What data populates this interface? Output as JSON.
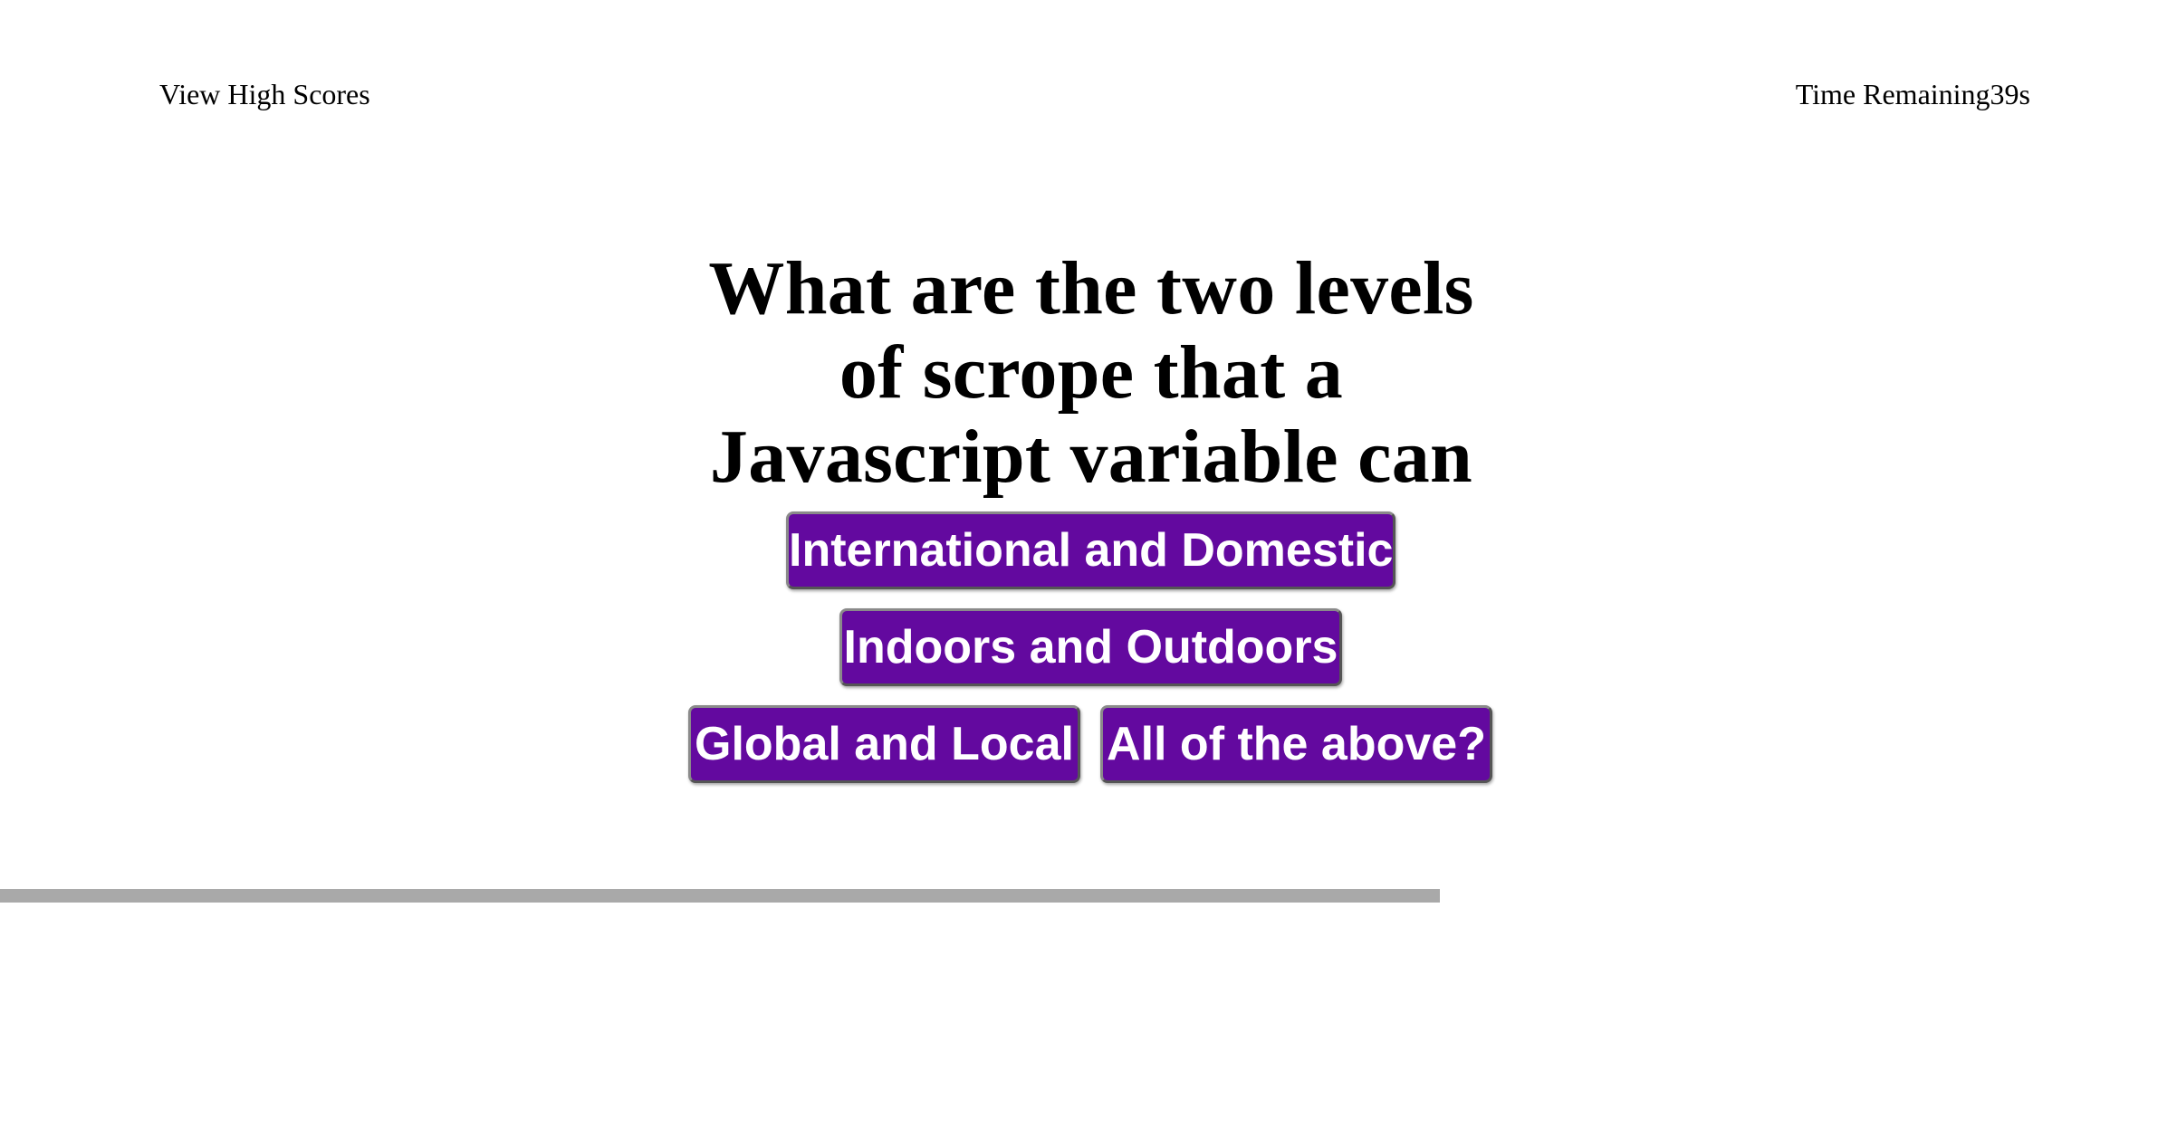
{
  "header": {
    "high_scores_link": "View High Scores",
    "timer_label": "Time Remaining",
    "timer_value": "39s"
  },
  "quiz": {
    "question": "What are the two levels of scrope that a Javascript variable can have?.",
    "answers": [
      "International and Domestic",
      "Indoors and Outdoors",
      "Global and Local",
      "All of the above?"
    ]
  },
  "colors": {
    "answer_button_bg": "#63099f",
    "answer_button_text": "#ffffff",
    "divider": "#a9a9a9",
    "page_bg": "#ffffff"
  }
}
